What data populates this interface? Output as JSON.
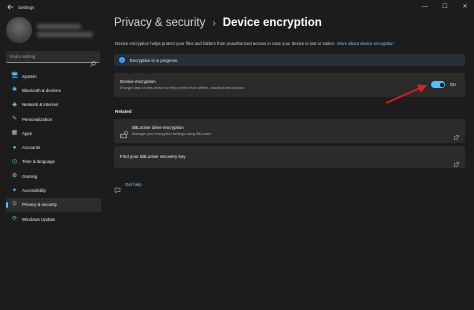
{
  "window": {
    "app_title": "Settings",
    "minimize_glyph": "—",
    "maximize_glyph": "☐",
    "close_glyph": "✕"
  },
  "profile": {
    "name": "",
    "email": ""
  },
  "search": {
    "placeholder": "Find a setting",
    "icon": "search-icon"
  },
  "sidebar": {
    "items": [
      {
        "label": "System",
        "icon": "monitor-icon",
        "glyph": "🖥",
        "color": "#4cc2ff"
      },
      {
        "label": "Bluetooth & devices",
        "icon": "bluetooth-icon",
        "glyph": "✱",
        "color": "#4cc2ff"
      },
      {
        "label": "Network & internet",
        "icon": "network-icon",
        "glyph": "◈",
        "color": "#9fd7ff"
      },
      {
        "label": "Personalization",
        "icon": "brush-icon",
        "glyph": "✎",
        "color": "#e8a862"
      },
      {
        "label": "Apps",
        "icon": "apps-icon",
        "glyph": "▦",
        "color": "#b9c4d0"
      },
      {
        "label": "Accounts",
        "icon": "person-icon",
        "glyph": "●",
        "color": "#5fd18e"
      },
      {
        "label": "Time & language",
        "icon": "globe-icon",
        "glyph": "◷",
        "color": "#4cc2ff"
      },
      {
        "label": "Gaming",
        "icon": "gamepad-icon",
        "glyph": "⊛",
        "color": "#c9c9c9"
      },
      {
        "label": "Accessibility",
        "icon": "accessibility-icon",
        "glyph": "✦",
        "color": "#4cc2ff"
      },
      {
        "label": "Privacy & security",
        "icon": "shield-icon",
        "glyph": "⛨",
        "color": "#9aa3ad"
      },
      {
        "label": "Windows Update",
        "icon": "update-icon",
        "glyph": "⟳",
        "color": "#4cc2ff"
      }
    ],
    "active_index": 9
  },
  "breadcrumb": {
    "parent": "Privacy & security",
    "separator": "›",
    "current": "Device encryption"
  },
  "description": {
    "text": "Device encryption helps protect your files and folders from unauthorized access in case your device is lost or stolen.",
    "link": "More about device encryption"
  },
  "info": {
    "text": "Encryption is in progress.",
    "glyph": "i"
  },
  "encryption": {
    "title": "Device encryption",
    "subtitle": "Encrypt data on this device to help protect from offline, unauthorized access",
    "toggle_on": true,
    "state_label": "On"
  },
  "related": {
    "heading": "Related",
    "bitlocker_title": "BitLocker drive encryption",
    "bitlocker_subtitle": "Manage your encryption settings using BitLocker",
    "recovery_title": "Find your BitLocker recovery key"
  },
  "help": {
    "label": "Get help"
  },
  "colors": {
    "accent": "#4cc2ff",
    "annotation_arrow": "#e0201c"
  }
}
